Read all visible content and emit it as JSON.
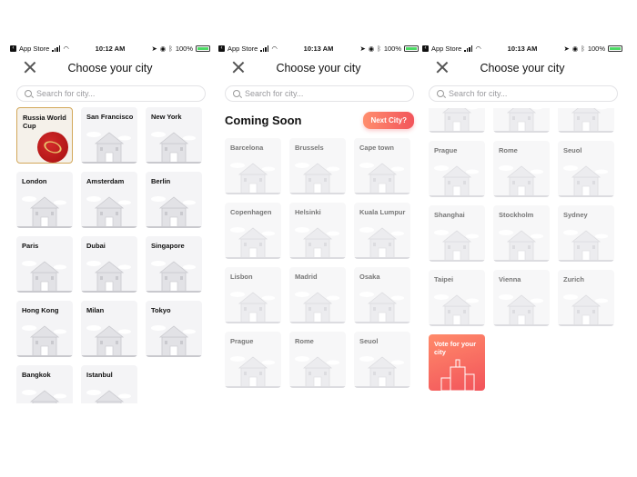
{
  "screens": [
    {
      "status": {
        "back_app": "App Store",
        "time": "10:12 AM",
        "battery": "100%"
      },
      "header": {
        "title": "Choose your city"
      },
      "search": {
        "placeholder": "Search for city..."
      },
      "cities": [
        {
          "name": "Russia World Cup",
          "featured": true,
          "icon": "world-cup-ball-icon"
        },
        {
          "name": "San Francisco",
          "icon": "golden-gate-bridge-icon"
        },
        {
          "name": "New York",
          "icon": "skyline-icon"
        },
        {
          "name": "London",
          "icon": "big-ben-icon"
        },
        {
          "name": "Amsterdam",
          "icon": "windmill-icon"
        },
        {
          "name": "Berlin",
          "icon": "brandenburg-gate-icon"
        },
        {
          "name": "Paris",
          "icon": "eiffel-tower-icon"
        },
        {
          "name": "Dubai",
          "icon": "burj-al-arab-icon"
        },
        {
          "name": "Singapore",
          "icon": "merlion-icon"
        },
        {
          "name": "Hong Kong",
          "icon": "junk-boat-icon"
        },
        {
          "name": "Milan",
          "icon": "duomo-icon"
        },
        {
          "name": "Tokyo",
          "icon": "pagoda-icon"
        },
        {
          "name": "Bangkok",
          "icon": "temple-icon"
        },
        {
          "name": "Istanbul",
          "icon": "mosque-icon"
        }
      ]
    },
    {
      "status": {
        "back_app": "App Store",
        "time": "10:13 AM",
        "battery": "100%"
      },
      "header": {
        "title": "Choose your city"
      },
      "search": {
        "placeholder": "Search for city..."
      },
      "section": {
        "heading": "Coming Soon",
        "button": "Next City?"
      },
      "cities": [
        {
          "name": "Barcelona",
          "icon": "sagrada-familia-icon"
        },
        {
          "name": "Brussels",
          "icon": "atomium-icon"
        },
        {
          "name": "Cape town",
          "icon": "cape-town-building-icon"
        },
        {
          "name": "Copenhagen",
          "icon": "copenhagen-church-icon"
        },
        {
          "name": "Helsinki",
          "icon": "helsinki-cathedral-icon"
        },
        {
          "name": "Kuala Lumpur",
          "icon": "petronas-towers-icon"
        },
        {
          "name": "Lisbon",
          "icon": "belem-tower-icon"
        },
        {
          "name": "Madrid",
          "icon": "madrid-gate-icon"
        },
        {
          "name": "Osaka",
          "icon": "osaka-castle-icon"
        },
        {
          "name": "Prague",
          "icon": "prague-church-icon"
        },
        {
          "name": "Rome",
          "icon": "colosseum-icon"
        },
        {
          "name": "Seuol",
          "icon": "seoul-palace-icon"
        }
      ]
    },
    {
      "status": {
        "back_app": "App Store",
        "time": "10:13 AM",
        "battery": "100%"
      },
      "header": {
        "title": "Choose your city"
      },
      "search": {
        "placeholder": "Search for city..."
      },
      "partial_icons": [
        "belem-tower-icon",
        "madrid-gate-icon",
        "osaka-castle-icon"
      ],
      "cities": [
        {
          "name": "Prague",
          "icon": "prague-church-icon"
        },
        {
          "name": "Rome",
          "icon": "colosseum-icon"
        },
        {
          "name": "Seuol",
          "icon": "seoul-palace-icon"
        },
        {
          "name": "Shanghai",
          "icon": "shanghai-tower-icon"
        },
        {
          "name": "Stockholm",
          "icon": "stockholm-city-hall-icon"
        },
        {
          "name": "Sydney",
          "icon": "opera-house-icon"
        },
        {
          "name": "Taipei",
          "icon": "taipei-101-icon"
        },
        {
          "name": "Vienna",
          "icon": "vienna-palace-icon"
        },
        {
          "name": "Zurich",
          "icon": "zurich-church-icon"
        }
      ],
      "vote": {
        "label": "Vote for your city",
        "icon": "vote-building-icon"
      }
    }
  ],
  "colors": {
    "accent_start": "#ff8e6e",
    "accent_end": "#f2545b",
    "featured_border": "#d3a85a",
    "battery": "#4cd964"
  }
}
